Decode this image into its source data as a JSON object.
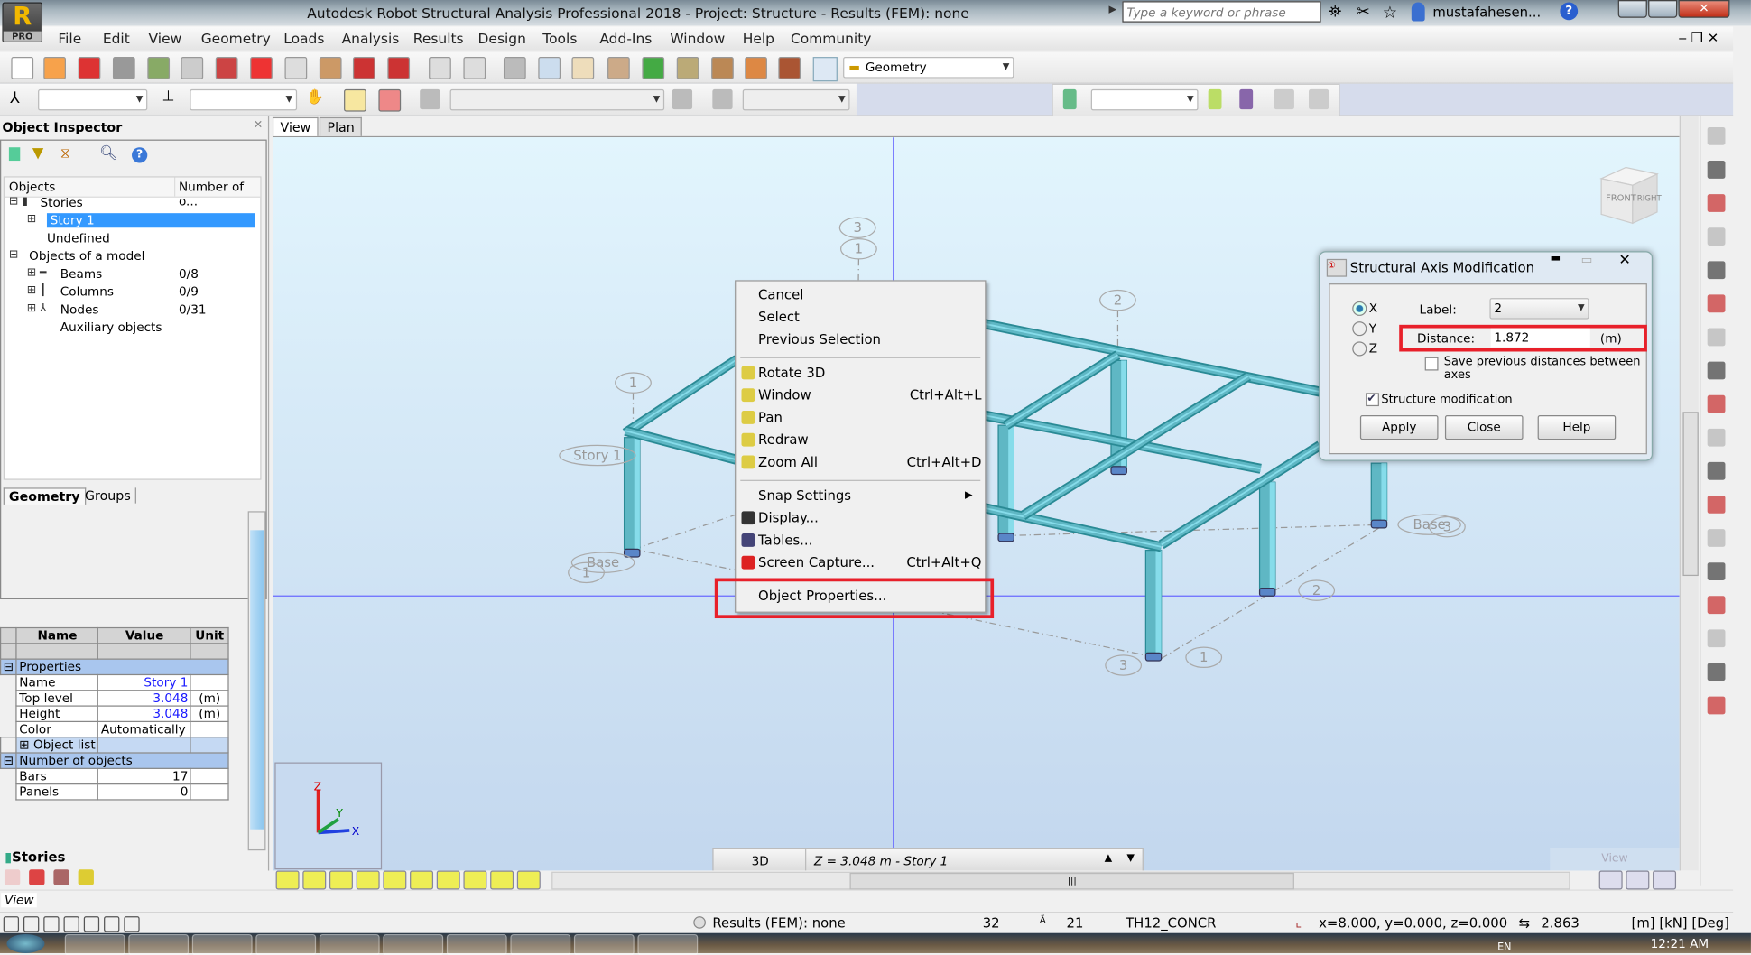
{
  "app": {
    "title": "Autodesk Robot Structural Analysis Professional 2018 - Project: Structure - Results (FEM): none",
    "logo_letter": "R",
    "logo_badge": "PRO",
    "search_placeholder": "Type a keyword or phrase",
    "user": "mustafahesen..."
  },
  "menu": [
    "File",
    "Edit",
    "View",
    "Geometry",
    "Loads",
    "Analysis",
    "Results",
    "Design",
    "Tools",
    "Add-Ins",
    "Window",
    "Help",
    "Community"
  ],
  "toolbar": {
    "icons": [
      "new-icon",
      "open-icon",
      "save-icon",
      "print-icon",
      "book-icon",
      "preview-icon",
      "camera-icon",
      "delete-icon",
      "copy-icon",
      "paste-icon",
      "undo-icon",
      "redo-icon",
      "calculator-icon",
      "calc-table-icon",
      "lock-icon",
      "zoom-window-icon",
      "zoom-all-icon",
      "zoom-select-icon",
      "redraw-icon",
      "measure-icon",
      "section-icon",
      "structure-icon",
      "tools-icon",
      "layout-icon"
    ],
    "layout_select": "Geometry"
  },
  "inspector": {
    "title": "Object Inspector",
    "col_objects": "Objects",
    "col_count": "Number of o...",
    "tree": [
      {
        "label": "Stories"
      },
      {
        "label": "Story 1",
        "selected": true
      },
      {
        "label": "Undefined"
      },
      {
        "label": "Objects of a model"
      },
      {
        "label": "Beams",
        "count": "0/8"
      },
      {
        "label": "Columns",
        "count": "0/9"
      },
      {
        "label": "Nodes",
        "count": "0/31"
      },
      {
        "label": "Auxiliary objects"
      }
    ],
    "tabs": [
      "Geometry",
      "Groups"
    ],
    "table_headers": [
      "Name",
      "Value",
      "Unit"
    ],
    "groups": {
      "properties": "Properties",
      "object_list": "Object list",
      "num_objects": "Number of objects"
    },
    "rows": [
      {
        "name": "Name",
        "value": "Story 1",
        "unit": ""
      },
      {
        "name": "Top level",
        "value": "3.048",
        "unit": "(m)"
      },
      {
        "name": "Height",
        "value": "3.048",
        "unit": "(m)"
      },
      {
        "name": "Color",
        "value": "Automatically",
        "unit": ""
      }
    ],
    "count_rows": [
      {
        "name": "Bars",
        "value": "17"
      },
      {
        "name": "Panels",
        "value": "0"
      }
    ],
    "bottom_tab": "Stories",
    "view_label": "View"
  },
  "viewport": {
    "tabs": [
      "View",
      "Plan"
    ],
    "axis_labels": [
      "3",
      "1",
      "2",
      "1",
      "Story 1",
      "Base",
      "1",
      "Base",
      "3",
      "2",
      "3",
      "1"
    ],
    "cube": [
      "FRONT",
      "RIGHT"
    ],
    "triad": [
      "Z",
      "Y",
      "X"
    ],
    "mode": "3D",
    "level": "Z = 3.048 m - Story 1",
    "view_btn": "View"
  },
  "context_menu": [
    {
      "label": "Cancel"
    },
    {
      "label": "Select"
    },
    {
      "label": "Previous Selection"
    },
    {
      "label": "Rotate 3D",
      "icon": "rotate-3d-icon"
    },
    {
      "label": "Window",
      "shortcut": "Ctrl+Alt+L",
      "icon": "zoom-window-icon"
    },
    {
      "label": "Pan",
      "icon": "pan-icon"
    },
    {
      "label": "Redraw",
      "icon": "redraw-icon"
    },
    {
      "label": "Zoom All",
      "shortcut": "Ctrl+Alt+D",
      "icon": "zoom-all-icon"
    },
    {
      "label": "Snap Settings",
      "submenu": true
    },
    {
      "label": "Display...",
      "icon": "display-icon"
    },
    {
      "label": "Tables...",
      "icon": "tables-icon"
    },
    {
      "label": "Screen Capture...",
      "shortcut": "Ctrl+Alt+Q",
      "icon": "camera-icon"
    },
    {
      "label": "Object Properties...",
      "highlighted_box": true
    }
  ],
  "dialog": {
    "title": "Structural Axis Modification",
    "axes": [
      "X",
      "Y",
      "Z"
    ],
    "selected_axis": "X",
    "label_caption": "Label:",
    "label_value": "2",
    "distance_caption": "Distance:",
    "distance_value": "1.872",
    "distance_unit": "(m)",
    "save_prev": "Save previous distances between axes",
    "save_prev_checked": false,
    "struct_mod": "Structure modification",
    "struct_mod_checked": true,
    "buttons": [
      "Apply",
      "Close",
      "Help"
    ]
  },
  "status": {
    "results": "Results (FEM): none",
    "n1": "32",
    "n2": "21",
    "section": "TH12_CONCR",
    "coords": "x=8.000, y=0.000, z=0.000",
    "dist": "2.863",
    "units": "[m] [kN] [Deg]"
  },
  "taskbar": {
    "lang": "EN",
    "time": "12:21 AM"
  },
  "colors": {
    "highlight": "#e8202a",
    "selection": "#3399ff",
    "structure": "#5fb7c4",
    "axis_line": "#6a6aff"
  }
}
